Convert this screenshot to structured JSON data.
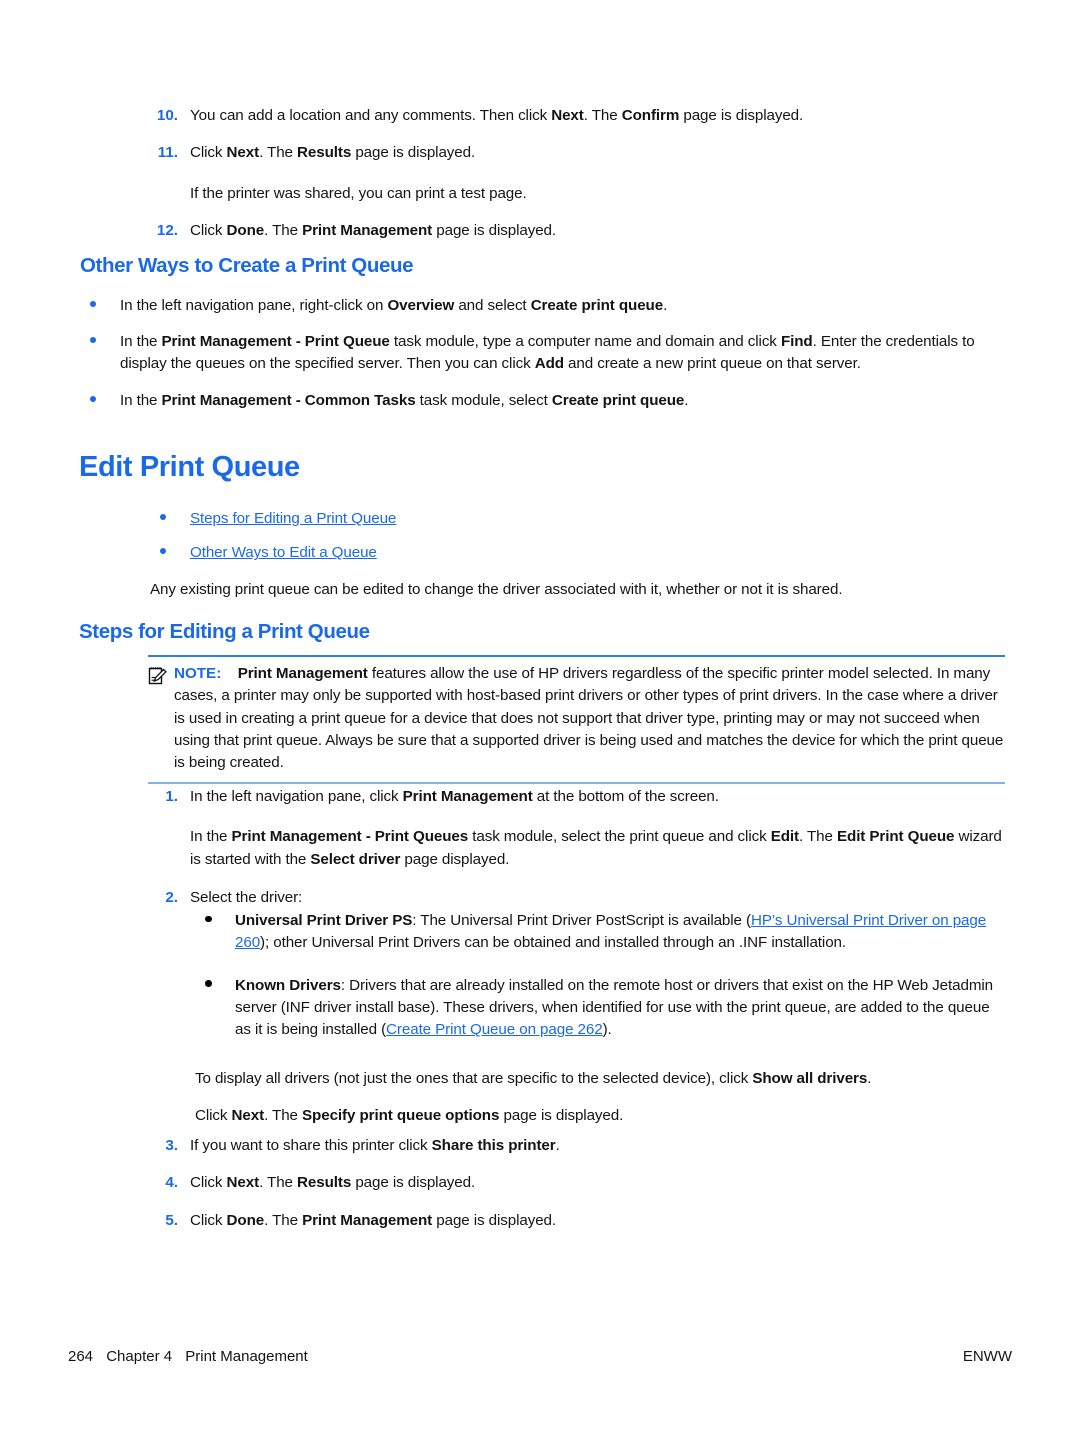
{
  "document": {
    "steps_continued": [
      {
        "number": "10.",
        "segments": [
          {
            "t": "You can add a location and any comments. Then click ",
            "b": false
          },
          {
            "t": "Next",
            "b": true
          },
          {
            "t": ". The ",
            "b": false
          },
          {
            "t": "Confirm",
            "b": true
          },
          {
            "t": " page is displayed.",
            "b": false
          }
        ]
      },
      {
        "number": "11.",
        "segments": [
          {
            "t": "Click ",
            "b": false
          },
          {
            "t": "Next",
            "b": true
          },
          {
            "t": ". The ",
            "b": false
          },
          {
            "t": "Results",
            "b": true
          },
          {
            "t": " page is displayed.",
            "b": false
          }
        ],
        "continuation": [
          [
            {
              "t": "If the printer was shared, you can print a test page.",
              "b": false
            }
          ]
        ]
      },
      {
        "number": "12.",
        "segments": [
          {
            "t": "Click ",
            "b": false
          },
          {
            "t": "Done",
            "b": true
          },
          {
            "t": ". The ",
            "b": false
          },
          {
            "t": "Print Management",
            "b": true
          },
          {
            "t": " page is displayed.",
            "b": false
          }
        ]
      }
    ],
    "other_ways_heading": "Other Ways to Create a Print Queue",
    "other_ways_bullets": [
      [
        {
          "t": "In the left navigation pane, right-click on ",
          "b": false
        },
        {
          "t": "Overview",
          "b": true
        },
        {
          "t": " and select ",
          "b": false
        },
        {
          "t": "Create print queue",
          "b": true
        },
        {
          "t": ".",
          "b": false
        }
      ],
      [
        {
          "t": "In the ",
          "b": false
        },
        {
          "t": "Print Management - Print Queue",
          "b": true
        },
        {
          "t": " task module, type a computer name and domain and click ",
          "b": false
        },
        {
          "t": "Find",
          "b": true
        },
        {
          "t": ". Enter the credentials to display the queues on the specified server. Then you can click ",
          "b": false
        },
        {
          "t": "Add",
          "b": true
        },
        {
          "t": " and create a new print queue on that server.",
          "b": false
        }
      ],
      [
        {
          "t": "In the ",
          "b": false
        },
        {
          "t": "Print Management - Common Tasks",
          "b": true
        },
        {
          "t": " task module, select ",
          "b": false
        },
        {
          "t": "Create print queue",
          "b": true
        },
        {
          "t": ".",
          "b": false
        }
      ]
    ],
    "edit_print_queue_heading": "Edit Print Queue",
    "toc_links": [
      "Steps for Editing a Print Queue",
      "Other Ways to Edit a Queue"
    ],
    "intro_paragraph": "Any existing print queue can be edited to change the driver associated with it, whether or not it is shared.",
    "steps_heading": "Steps for Editing a Print Queue",
    "note": {
      "icon": "note-pencil-icon",
      "label": "NOTE:",
      "segments": [
        {
          "t": "Print Management",
          "b": true
        },
        {
          "t": " features allow the use of HP drivers regardless of the specific printer model selected. In many cases, a printer may only be supported with host-based print drivers or other types of print drivers. In the case where a driver is used in creating a print queue for a device that does not support that driver type, printing may or may not succeed when using that print queue. Always be sure that a supported driver is being used and matches the device for which the print queue is being created.",
          "b": false
        }
      ]
    },
    "edit_steps": [
      {
        "number": "1.",
        "segments": [
          {
            "t": "In the left navigation pane, click ",
            "b": false
          },
          {
            "t": "Print Management",
            "b": true
          },
          {
            "t": " at the bottom of the screen.",
            "b": false
          }
        ],
        "continuation": [
          [
            {
              "t": "In the ",
              "b": false
            },
            {
              "t": "Print Management - Print Queues",
              "b": true
            },
            {
              "t": " task module, select the print queue and click ",
              "b": false
            },
            {
              "t": "Edit",
              "b": true
            },
            {
              "t": ". The ",
              "b": false
            },
            {
              "t": "Edit Print Queue",
              "b": true
            },
            {
              "t": " wizard is started with the ",
              "b": false
            },
            {
              "t": "Select driver",
              "b": true
            },
            {
              "t": " page displayed.",
              "b": false
            }
          ]
        ]
      },
      {
        "number": "2.",
        "segments": [
          {
            "t": "Select the driver:",
            "b": false
          }
        ]
      },
      {
        "number": "3.",
        "segments": [
          {
            "t": "If you want to share this printer click ",
            "b": false
          },
          {
            "t": "Share this printer",
            "b": true
          },
          {
            "t": ".",
            "b": false
          }
        ]
      },
      {
        "number": "4.",
        "segments": [
          {
            "t": "Click ",
            "b": false
          },
          {
            "t": "Next",
            "b": true
          },
          {
            "t": ". The ",
            "b": false
          },
          {
            "t": "Results",
            "b": true
          },
          {
            "t": " page is displayed.",
            "b": false
          }
        ]
      },
      {
        "number": "5.",
        "segments": [
          {
            "t": "Click ",
            "b": false
          },
          {
            "t": "Done",
            "b": true
          },
          {
            "t": ". The ",
            "b": false
          },
          {
            "t": "Print Management",
            "b": true
          },
          {
            "t": " page is displayed.",
            "b": false
          }
        ]
      }
    ],
    "driver_bullets": [
      [
        {
          "t": "Universal Print Driver PS",
          "b": true
        },
        {
          "t": ": The Universal Print Driver PostScript is available (",
          "b": false
        },
        {
          "t": "HP’s Universal Print Driver on page 260",
          "b": false,
          "link": true
        },
        {
          "t": "); other Universal Print Drivers can be obtained and installed through an .INF installation.",
          "b": false
        }
      ],
      [
        {
          "t": "Known Drivers",
          "b": true
        },
        {
          "t": ": Drivers that are already installed on the remote host or drivers that exist on the HP Web Jetadmin server (INF driver install base). These drivers, when identified for use with the print queue, are added to the queue as it is being installed (",
          "b": false
        },
        {
          "t": "Create Print Queue on page 262",
          "b": false,
          "link": true
        },
        {
          "t": ").",
          "b": false
        }
      ]
    ],
    "after_drivers": [
      [
        {
          "t": "To display all drivers (not just the ones that are specific to the selected device), click ",
          "b": false
        },
        {
          "t": "Show all drivers",
          "b": true
        },
        {
          "t": ".",
          "b": false
        }
      ],
      [
        {
          "t": "Click ",
          "b": false
        },
        {
          "t": "Next",
          "b": true
        },
        {
          "t": ". The ",
          "b": false
        },
        {
          "t": "Specify print queue options",
          "b": true
        },
        {
          "t": " page is displayed.",
          "b": false
        }
      ]
    ],
    "footer": {
      "page_number": "264",
      "chapter": "Chapter 4",
      "chapter_title": "Print Management",
      "right": "ENWW"
    },
    "colors": {
      "accent_blue": "#1a6ae8",
      "note_top_border": "#2f7fe0",
      "note_bottom_border": "#7fb3ea",
      "body_text": "#141414"
    }
  }
}
